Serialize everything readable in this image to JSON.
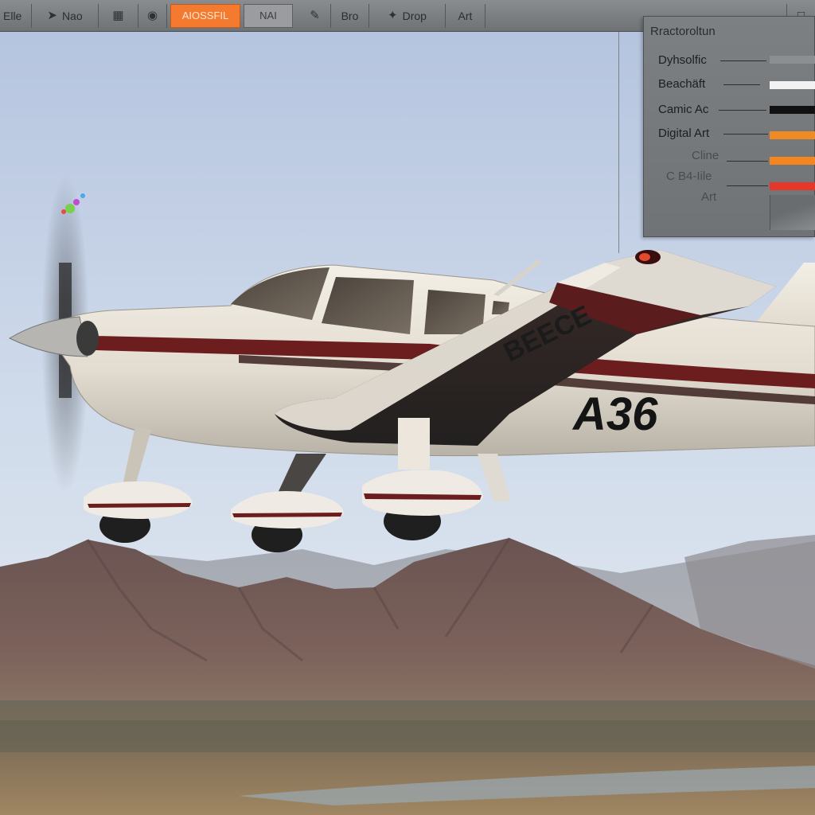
{
  "toolbar": {
    "items": [
      {
        "label": "Elle",
        "icon": "file-icon"
      },
      {
        "label": "Nao",
        "icon": "navigate-icon"
      },
      {
        "label": "",
        "icon": "grid-icon"
      },
      {
        "label": "",
        "icon": "mask-icon"
      },
      {
        "label": "AIOSSFIL",
        "icon": "",
        "active": true
      },
      {
        "label": "NAI",
        "icon": ""
      },
      {
        "label": "",
        "icon": "brush-icon"
      },
      {
        "label": "Bro",
        "icon": ""
      },
      {
        "label": "Drop",
        "icon": "drop-icon"
      },
      {
        "label": "Art",
        "icon": ""
      }
    ],
    "accent_color": "#f37a2e"
  },
  "style_panel": {
    "title": "Rractoroltun",
    "styles": [
      {
        "label": "Dyhsolfic",
        "color": "#8c8f92"
      },
      {
        "label": "Beachäft",
        "color": "#f2f2f2"
      },
      {
        "label": "Camic Ac",
        "color": "#111111"
      },
      {
        "label": "Digital Art",
        "color": "#f08a22"
      },
      {
        "label": "Cline",
        "color": "#f5861f"
      },
      {
        "label": "C B4-Iile",
        "color": "#e5372a"
      },
      {
        "label": "Art",
        "color": ""
      }
    ]
  },
  "canvas": {
    "aircraft_tail_text": "A36",
    "wing_text": "BEECE",
    "sky_color": "#c6d5e8",
    "mountain_color": "#6f5650"
  }
}
